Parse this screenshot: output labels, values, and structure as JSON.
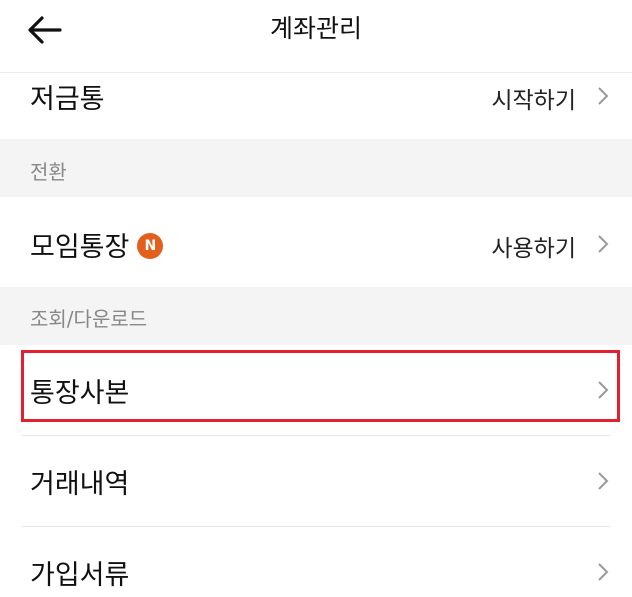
{
  "header": {
    "title": "계좌관리",
    "back_icon": "arrow-left-icon"
  },
  "rows": {
    "savings": {
      "label": "저금통",
      "action": "시작하기"
    },
    "group_account": {
      "label": "모임통장",
      "badge": "N",
      "action": "사용하기"
    },
    "account_copy": {
      "label": "통장사본"
    },
    "transactions": {
      "label": "거래내역"
    },
    "documents": {
      "label": "가입서류"
    }
  },
  "sections": {
    "switch": "전환",
    "lookup": "조회/다운로드"
  },
  "colors": {
    "badge": "#e35f1d",
    "highlight": "#e3202f",
    "section_bg": "#f4f4f4"
  }
}
